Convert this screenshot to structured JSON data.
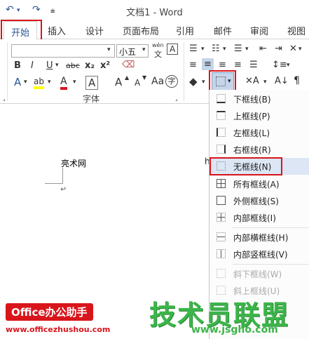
{
  "window": {
    "title": "文档1 - Word",
    "quick_access": {
      "undo": "↶",
      "redo": "↷",
      "customize": "⩧"
    }
  },
  "tabs": [
    "开始",
    "插入",
    "设计",
    "页面布局",
    "引用",
    "邮件",
    "审阅",
    "视图"
  ],
  "ribbon": {
    "font_name": "",
    "font_size": "小五",
    "wen_label": "wén",
    "wen_char": "文",
    "bold": "B",
    "italic": "I",
    "underline": "U",
    "strike": "abc",
    "subscript": "x₂",
    "superscript": "x²",
    "text_effect": "A",
    "highlight": "ab",
    "font_color": "A",
    "grow_font": "A",
    "shrink_font": "A",
    "char_shade": "A",
    "enclose": "字",
    "font_group_label": "字体"
  },
  "document": {
    "text": "亮术网",
    "para_mark": "↵",
    "edge_char": "h"
  },
  "border_menu": {
    "items": [
      {
        "label": "下框线(B)",
        "icon": "bottom-border-icon",
        "disabled": false
      },
      {
        "label": "上框线(P)",
        "icon": "top-border-icon",
        "disabled": false
      },
      {
        "label": "左框线(L)",
        "icon": "left-border-icon",
        "disabled": false
      },
      {
        "label": "右框线(R)",
        "icon": "right-border-icon",
        "disabled": false
      },
      {
        "label": "无框线(N)",
        "icon": "no-border-icon",
        "disabled": false,
        "highlighted": true
      },
      {
        "label": "所有框线(A)",
        "icon": "all-borders-icon",
        "disabled": false
      },
      {
        "label": "外侧框线(S)",
        "icon": "outside-borders-icon",
        "disabled": false
      },
      {
        "label": "内部框线(I)",
        "icon": "inside-borders-icon",
        "disabled": false
      },
      {
        "label": "内部横框线(H)",
        "icon": "inside-horizontal-border-icon",
        "disabled": false
      },
      {
        "label": "内部竖框线(V)",
        "icon": "inside-vertical-border-icon",
        "disabled": false
      },
      {
        "label": "斜下框线(W)",
        "icon": "diagonal-down-border-icon",
        "disabled": true
      },
      {
        "label": "斜上框线(U)",
        "icon": "diagonal-up-border-icon",
        "disabled": true
      }
    ]
  },
  "watermark": {
    "left_badge": "Office办公助手",
    "left_url": "www.officezhushou.com",
    "right_logo": "技术员联盟",
    "right_url": "www.jsgho.com"
  },
  "colors": {
    "accent": "#2b579a",
    "red_annotation": "#d9151c",
    "menu_highlight": "#dce6f4",
    "watermark_green": "#3cb54a"
  }
}
